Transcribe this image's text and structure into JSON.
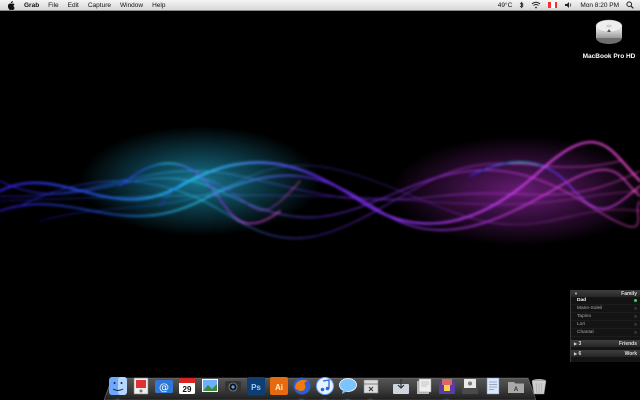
{
  "menubar": {
    "app_name": "Grab",
    "menus": [
      "File",
      "Edit",
      "Capture",
      "Window",
      "Help"
    ],
    "status": {
      "temperature": "49°C",
      "clock": "Mon 8:20 PM"
    },
    "icons": [
      "apple-icon",
      "wifi-icon",
      "flag-icon",
      "bluetooth-icon",
      "volume-icon",
      "spotlight-icon"
    ]
  },
  "desktop": {
    "drive_label": "MacBook Pro HD"
  },
  "buddy_list": {
    "groups": [
      {
        "name": "Family",
        "expanded": true,
        "count": "",
        "buddies": [
          {
            "name": "Dad",
            "online": true
          },
          {
            "name": "Marie-Soleil",
            "online": false
          },
          {
            "name": "Tapino",
            "online": false
          },
          {
            "name": "Lori",
            "online": false
          },
          {
            "name": "Chantal",
            "online": false
          }
        ]
      },
      {
        "name": "Friends",
        "expanded": false,
        "count": "3"
      },
      {
        "name": "Work",
        "expanded": false,
        "count": "6"
      }
    ]
  },
  "dock": {
    "calendar_day": "29",
    "ps_label": "Ps",
    "ai_label": "Ai",
    "items": [
      "finder",
      "preview",
      "mail",
      "calendar",
      "iphoto",
      "photo-booth",
      "photoshop",
      "illustrator",
      "firefox",
      "itunes",
      "ichat",
      "grab"
    ],
    "stacks": [
      "downloads",
      "documents",
      "applications",
      "pictures",
      "text",
      "folder"
    ]
  },
  "colors": {
    "menubar_bg": "#e8e8e8",
    "accent_cyan": "#22d4ff",
    "accent_magenta": "#e23cff",
    "online_green": "#36d65a"
  }
}
